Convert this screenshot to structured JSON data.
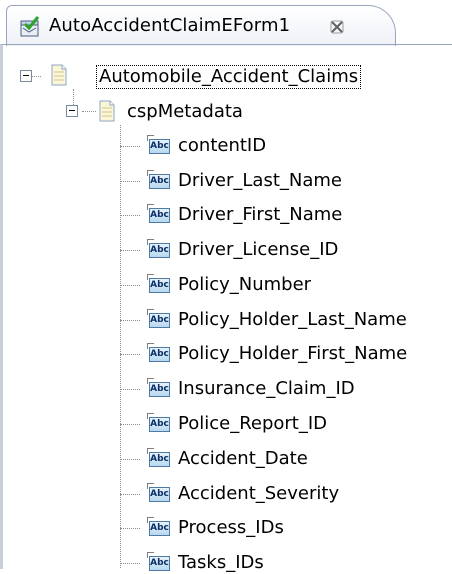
{
  "tab": {
    "title": "AutoAccidentClaimEForm1",
    "icon": "eform-document-icon",
    "close_icon": "close-icon"
  },
  "tree": {
    "root": {
      "label": "Automobile_Accident_Claims",
      "expanded": true
    },
    "metadata": {
      "label": "cspMetadata",
      "expanded": true
    },
    "fields": [
      "contentID",
      "Driver_Last_Name",
      "Driver_First_Name",
      "Driver_License_ID",
      "Policy_Number",
      "Policy_Holder_Last_Name",
      "Policy_Holder_First_Name",
      "Insurance_Claim_ID",
      "Police_Report_ID",
      "Accident_Date",
      "Accident_Severity",
      "Process_IDs",
      "Tasks_IDs"
    ],
    "field_icon_text": "Abc"
  }
}
